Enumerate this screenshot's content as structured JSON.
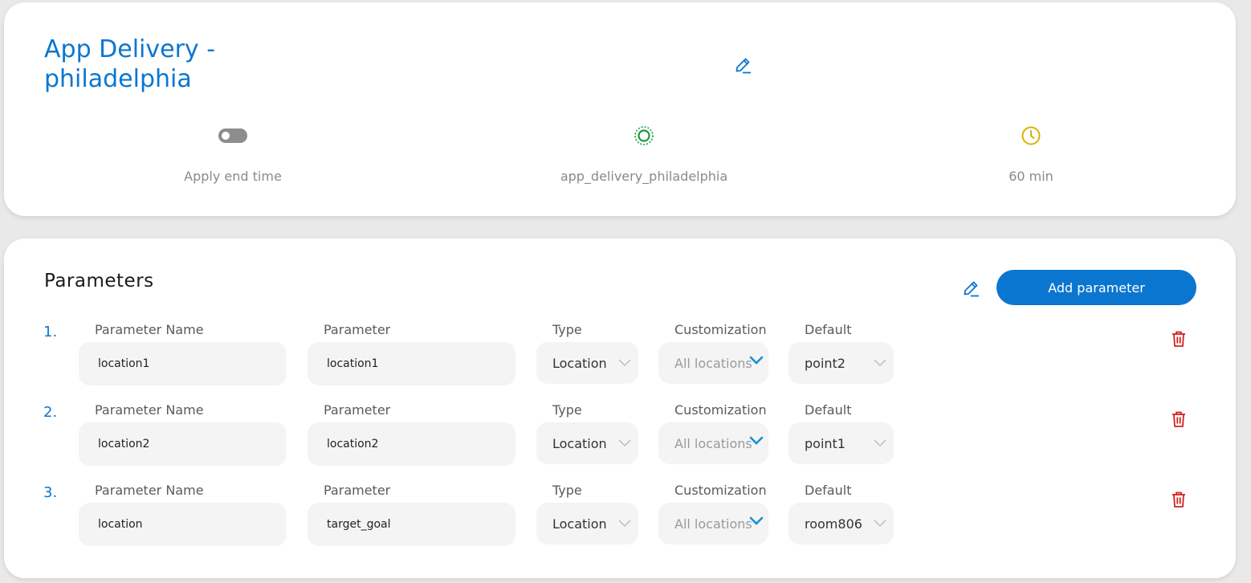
{
  "header": {
    "title": "App Delivery - philadelphia",
    "end_time_label": "Apply end time",
    "end_time_enabled": false,
    "mission_name": "app_delivery_philadelphia",
    "duration": "60 min",
    "colors": {
      "accent": "#0b76d0",
      "status_green": "#1a9a3a",
      "clock_yellow": "#d8b400"
    }
  },
  "parameters": {
    "title": "Parameters",
    "add_button_label": "Add parameter",
    "labels": {
      "parameter_name": "Parameter Name",
      "parameter": "Parameter",
      "type": "Type",
      "customization": "Customization",
      "default": "Default"
    },
    "rows": [
      {
        "num": "1.",
        "name": "location1",
        "parameter": "location1",
        "type": "Location",
        "customization": "All locations",
        "default": "point2"
      },
      {
        "num": "2.",
        "name": "location2",
        "parameter": "location2",
        "type": "Location",
        "customization": "All locations",
        "default": "point1"
      },
      {
        "num": "3.",
        "name": "location",
        "parameter": "target_goal",
        "type": "Location",
        "customization": "All locations",
        "default": "room806"
      }
    ],
    "delete_color": "#d32020"
  }
}
